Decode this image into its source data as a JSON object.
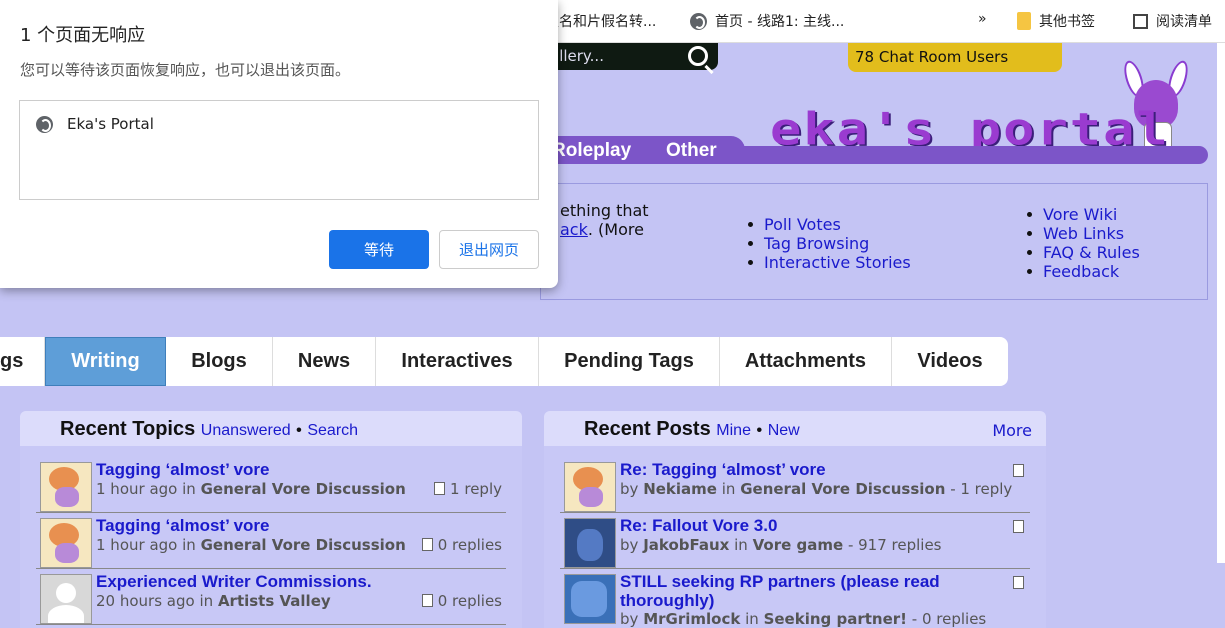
{
  "bookmarks": {
    "item1": "假名和片假名转...",
    "item2": "首页 - 线路1: 主线...",
    "overflow": "»",
    "other": "其他书签",
    "reading": "阅读清单"
  },
  "site": {
    "search_placeholder": "allery...",
    "chat": "78 Chat Room Users",
    "nav": [
      "Roleplay",
      "Other"
    ],
    "logo": "eka's portal",
    "intro_line1": "ething  that",
    "intro_link": "ack",
    "intro_rest": ". (More",
    "links_col1": [
      "Poll Votes",
      "Tag Browsing",
      "Interactive Stories"
    ],
    "links_col2": [
      "Vore Wiki",
      "Web Links",
      "FAQ & Rules",
      "Feedback"
    ],
    "tabs": [
      "gs",
      "Writing",
      "Blogs",
      "News",
      "Interactives",
      "Pending Tags",
      "Attachments",
      "Videos"
    ]
  },
  "topics": {
    "title": "Recent Topics",
    "unanswered": "Unanswered",
    "dot": "•",
    "search": "Search",
    "rows": [
      {
        "title": "Tagging ‘almost’ vore",
        "time": "1 hour ago",
        "in": "in",
        "forum": "General Vore Discussion",
        "count": "1 reply"
      },
      {
        "title": "Tagging ‘almost’ vore",
        "time": "1 hour ago",
        "in": "in",
        "forum": "General Vore Discussion",
        "count": "0 replies"
      },
      {
        "title": "Experienced Writer Commissions.",
        "time": "20 hours ago",
        "in": "in",
        "forum": "Artists Valley",
        "count": "0 replies"
      }
    ]
  },
  "posts": {
    "title": "Recent Posts",
    "mine": "Mine",
    "dot": "•",
    "new": "New",
    "more": "More",
    "rows": [
      {
        "title": "Re: Tagging ‘almost’ vore",
        "by": "by",
        "user": "Nekiame",
        "in": "in",
        "forum": "General Vore Discussion",
        "count": "- 1 reply"
      },
      {
        "title": "Re: Fallout Vore 3.0",
        "by": "by",
        "user": "JakobFaux",
        "in": "in",
        "forum": "Vore game",
        "count": "- 917 replies"
      },
      {
        "title": "STILL seeking RP partners (please read",
        "title2": "thoroughly)",
        "by": "by",
        "user": "MrGrimlock",
        "in": "in",
        "forum": "Seeking partner!",
        "count": "- 0 replies"
      }
    ]
  },
  "dialog": {
    "title": "1 个页面无响应",
    "message": "您可以等待该页面恢复响应，也可以退出该页面。",
    "item": "Eka's Portal",
    "wait": "等待",
    "exit": "退出网页"
  }
}
